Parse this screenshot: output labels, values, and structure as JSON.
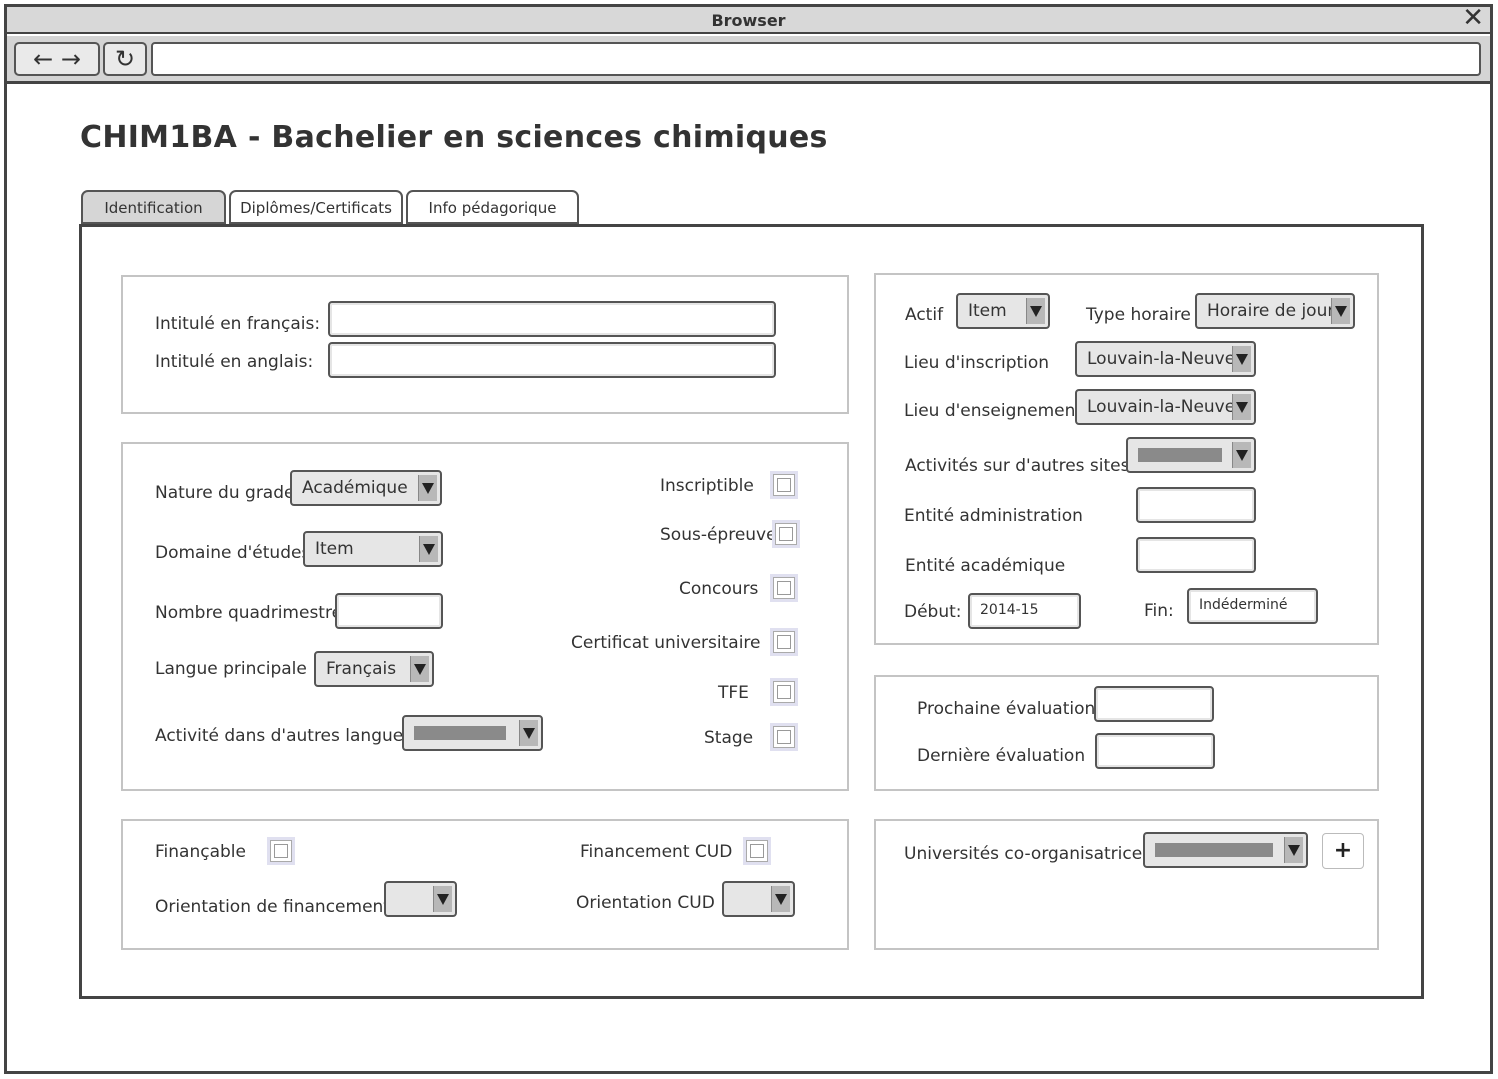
{
  "window": {
    "title": "Browser"
  },
  "page": {
    "title": "CHIM1BA - Bachelier en sciences chimiques"
  },
  "tabs": [
    "Identification",
    "Diplômes/Certificats",
    "Info pédagorique"
  ],
  "titles_group": {
    "fr_label": "Intitulé en français:",
    "en_label": "Intitulé en anglais:",
    "fr_value": "",
    "en_value": ""
  },
  "grade_group": {
    "nature_label": "Nature du grade",
    "nature_value": "Académique",
    "domaine_label": "Domaine d'études",
    "domaine_value": "Item",
    "quadri_label": "Nombre quadrimestre",
    "quadri_value": "",
    "langue_label": "Langue principale",
    "langue_value": "Français",
    "autres_langues_label": "Activité dans d'autres langues",
    "inscriptible_label": "Inscriptible",
    "sous_epreuve_label": "Sous-épreuve",
    "concours_label": "Concours",
    "certificat_label": "Certificat universitaire",
    "tfe_label": "TFE",
    "stage_label": "Stage"
  },
  "financing_group": {
    "financable_label": "Finançable",
    "orientation_label": "Orientation de financement",
    "cud_label": "Financement CUD",
    "orientation_cud_label": "Orientation CUD"
  },
  "right_group": {
    "actif_label": "Actif",
    "actif_value": "Item",
    "type_label": "Type horaire",
    "type_value": "Horaire de jour",
    "lieu_inscr_label": "Lieu d'inscription",
    "lieu_inscr_value": "Louvain-la-Neuve",
    "lieu_ens_label": "Lieu d'enseignement",
    "lieu_ens_value": "Louvain-la-Neuve",
    "autres_sites_label": "Activités sur d'autres sites",
    "entite_admin_label": "Entité administration",
    "entite_acad_label": "Entité académique",
    "debut_label": "Début:",
    "debut_value": "2014-15",
    "fin_label": "Fin:",
    "fin_value": "Indéderminé"
  },
  "eval_group": {
    "prochaine_label": "Prochaine évaluation",
    "derniere_label": "Dernière évaluation"
  },
  "univ_group": {
    "label": "Universités co-organisatrices",
    "add_label": "+"
  },
  "icons": {
    "back": "arrow-left-icon",
    "forward": "arrow-right-icon",
    "reload": "reload-icon",
    "close": "close-icon"
  }
}
